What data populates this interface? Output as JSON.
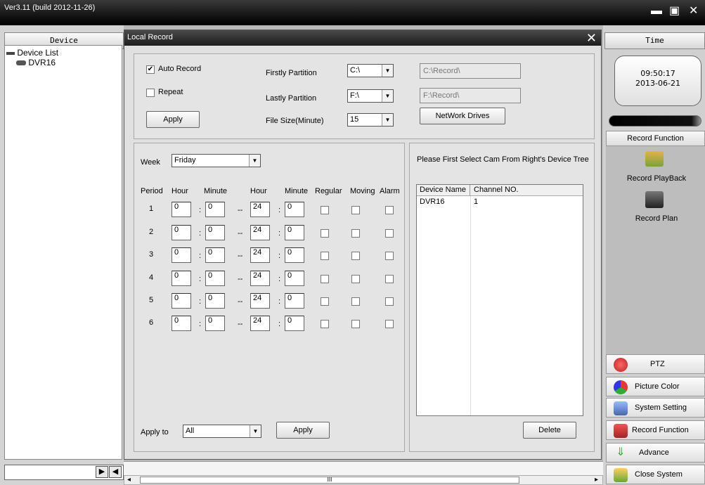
{
  "app": {
    "version": "Ver3.11 (build 2012-11-26)",
    "minimize": "▬",
    "restore": "▣",
    "close": "✕"
  },
  "left": {
    "header": "Device",
    "tree": [
      {
        "label": "Device List"
      },
      {
        "label": "DVR16"
      }
    ],
    "nav_play": "▶",
    "nav_back": "◀"
  },
  "right": {
    "header": "Time",
    "time": "09:50:17",
    "date": "2013-06-21",
    "record_function_header": "Record Function",
    "record_playback": "Record PlayBack",
    "record_plan": "Record Plan",
    "buttons": [
      "PTZ",
      "Picture Color",
      "System Setting",
      "Record Function",
      "Advance",
      "Close System"
    ]
  },
  "dialog": {
    "title": "Local Record",
    "close": "✕",
    "auto_record": "Auto Record",
    "repeat": "Repeat",
    "apply": "Apply",
    "firstly_partition_label": "Firstly Partition",
    "firstly_partition": "C:\\",
    "firstly_path": "C:\\Record\\",
    "lastly_partition_label": "Lastly Partition",
    "lastly_partition": "F:\\",
    "lastly_path": "F:\\Record\\",
    "file_size_label": "File Size(Minute)",
    "file_size": "15",
    "network_drives": "NetWork Drives",
    "week_label": "Week",
    "week": "Friday",
    "cols": {
      "period": "Period",
      "hour": "Hour",
      "minute": "Minute",
      "hour2": "Hour",
      "minute2": "Minute",
      "regular": "Regular",
      "moving": "Moving",
      "alarm": "Alarm"
    },
    "periods": [
      {
        "n": "1",
        "h1": "0",
        "m1": "0",
        "h2": "24",
        "m2": "0"
      },
      {
        "n": "2",
        "h1": "0",
        "m1": "0",
        "h2": "24",
        "m2": "0"
      },
      {
        "n": "3",
        "h1": "0",
        "m1": "0",
        "h2": "24",
        "m2": "0"
      },
      {
        "n": "4",
        "h1": "0",
        "m1": "0",
        "h2": "24",
        "m2": "0"
      },
      {
        "n": "5",
        "h1": "0",
        "m1": "0",
        "h2": "24",
        "m2": "0"
      },
      {
        "n": "6",
        "h1": "0",
        "m1": "0",
        "h2": "24",
        "m2": "0"
      }
    ],
    "colon": ":",
    "dash": "--",
    "apply_to_label": "Apply to",
    "apply_to": "All",
    "apply2": "Apply",
    "hint": "Please First Select Cam From Right's Device Tree",
    "table": {
      "col1": "Device Name",
      "col2": "Channel NO.",
      "rows": [
        {
          "name": "DVR16",
          "channel": "1"
        }
      ]
    },
    "delete": "Delete"
  },
  "scroll": {
    "thumb": "III",
    "left": "◂",
    "right": "▸"
  }
}
